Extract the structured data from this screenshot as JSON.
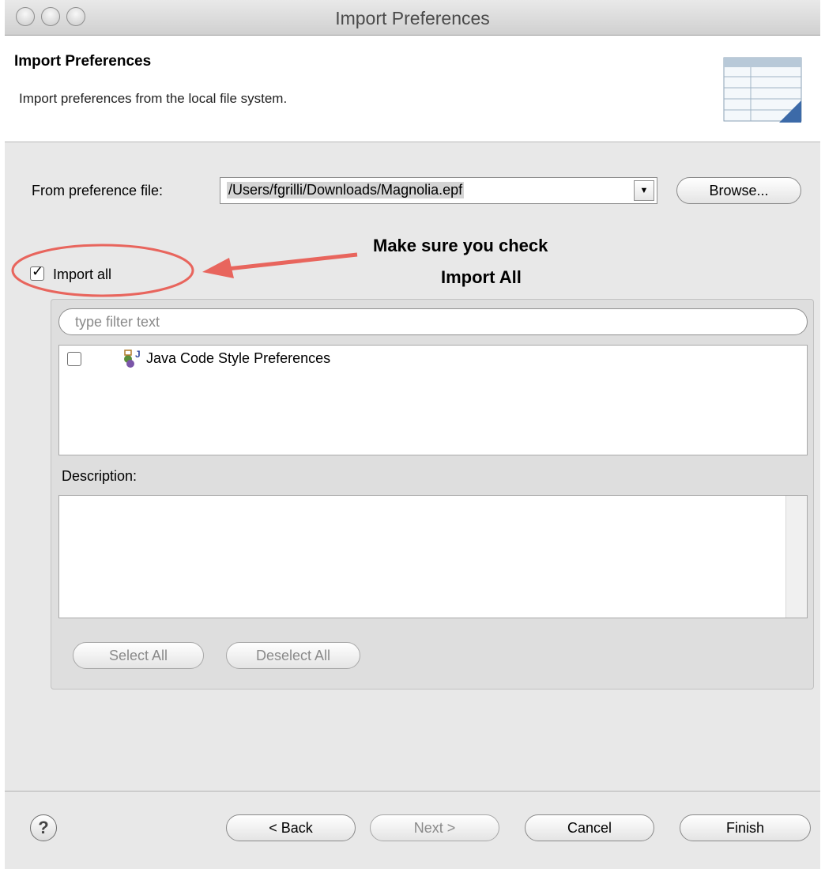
{
  "window": {
    "title": "Import Preferences"
  },
  "header": {
    "title": "Import Preferences",
    "description": "Import preferences from the local file system."
  },
  "form": {
    "from_label": "From preference file:",
    "file_value": "/Users/fgrilli/Downloads/Magnolia.epf",
    "browse_label": "Browse...",
    "import_all_label": "Import all",
    "import_all_checked": true
  },
  "annotation": {
    "line1": "Make sure you check",
    "line2": "Import All",
    "color": "#e8655d"
  },
  "filter": {
    "placeholder": "type filter text"
  },
  "tree": {
    "items": [
      {
        "label": "Java Code Style Preferences",
        "checked": false,
        "icon": "java-prefs-icon"
      }
    ]
  },
  "description": {
    "label": "Description:"
  },
  "buttons": {
    "select_all": "Select All",
    "deselect_all": "Deselect All",
    "back": "< Back",
    "next": "Next >",
    "cancel": "Cancel",
    "finish": "Finish"
  },
  "icons": {
    "help": "help-icon",
    "banner": "import-wizard-banner-icon"
  }
}
